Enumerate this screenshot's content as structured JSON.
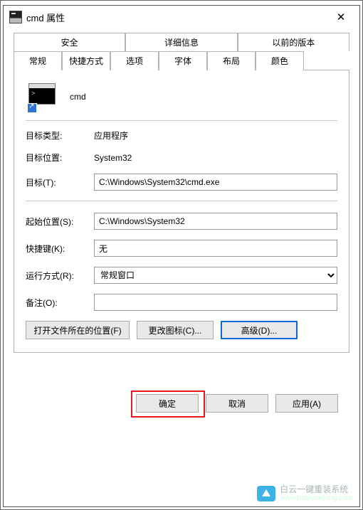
{
  "window": {
    "title": "cmd 属性",
    "close": "✕"
  },
  "tabs_row1": [
    {
      "label": "安全"
    },
    {
      "label": "详细信息"
    },
    {
      "label": "以前的版本"
    }
  ],
  "tabs_row2": [
    {
      "label": "常规"
    },
    {
      "label": "快捷方式"
    },
    {
      "label": "选项"
    },
    {
      "label": "字体"
    },
    {
      "label": "布局"
    },
    {
      "label": "颜色"
    }
  ],
  "shortcut": {
    "name": "cmd"
  },
  "labels": {
    "target_type": "目标类型:",
    "target_loc": "目标位置:",
    "target": "目标(T):",
    "start_in": "起始位置(S):",
    "hotkey": "快捷键(K):",
    "run": "运行方式(R):",
    "comment": "备注(O):"
  },
  "values": {
    "target_type": "应用程序",
    "target_loc": "System32",
    "target": "C:\\Windows\\System32\\cmd.exe",
    "start_in": "C:\\Windows\\System32",
    "hotkey": "无",
    "run": "常规窗口",
    "comment": ""
  },
  "panel_buttons": {
    "open_file_location": "打开文件所在的位置(F)",
    "change_icon": "更改图标(C)...",
    "advanced": "高级(D)..."
  },
  "dialog_buttons": {
    "ok": "确定",
    "cancel": "取消",
    "apply": "应用(A)"
  },
  "watermark": {
    "brand": "白云一键重装系统",
    "domain": "www.baiyunxitong.com"
  }
}
